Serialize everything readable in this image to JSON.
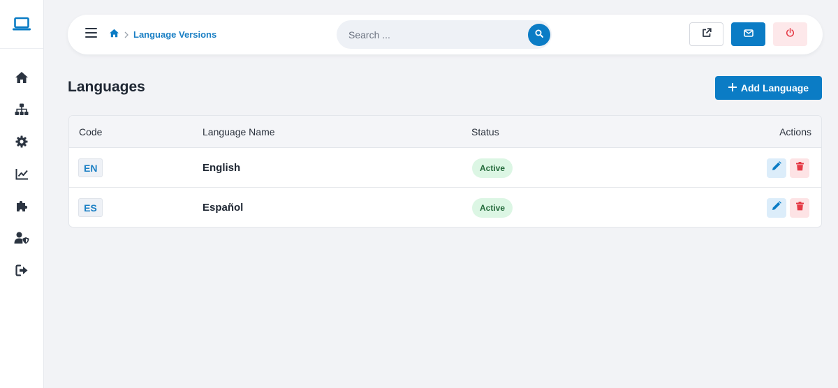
{
  "header": {
    "breadcrumb": [
      "Language Versions"
    ],
    "search_placeholder": "Search ..."
  },
  "sidebar": {
    "brand_icon": "laptop-icon",
    "items": [
      {
        "icon": "home-icon"
      },
      {
        "icon": "sitemap-icon"
      },
      {
        "icon": "gear-icon"
      },
      {
        "icon": "chart-line-icon"
      },
      {
        "icon": "puzzle-icon"
      },
      {
        "icon": "user-shield-icon"
      },
      {
        "icon": "logout-icon"
      }
    ]
  },
  "toolbar": {
    "external_icon": "external-link-icon",
    "mail_icon": "envelope-icon",
    "power_icon": "power-icon"
  },
  "page": {
    "title": "Languages",
    "add_button": "Add Language"
  },
  "table": {
    "columns": [
      "Code",
      "Language Name",
      "Status",
      "Actions"
    ],
    "rows": [
      {
        "code": "EN",
        "name": "English",
        "status": "Active"
      },
      {
        "code": "ES",
        "name": "Español",
        "status": "Active"
      }
    ]
  },
  "colors": {
    "primary": "#0b7cc5",
    "link": "#1a7fc4",
    "active_bg": "#dcf6e4",
    "active_text": "#256b3c",
    "danger": "#e53945",
    "danger_bg": "#fde3e5"
  }
}
